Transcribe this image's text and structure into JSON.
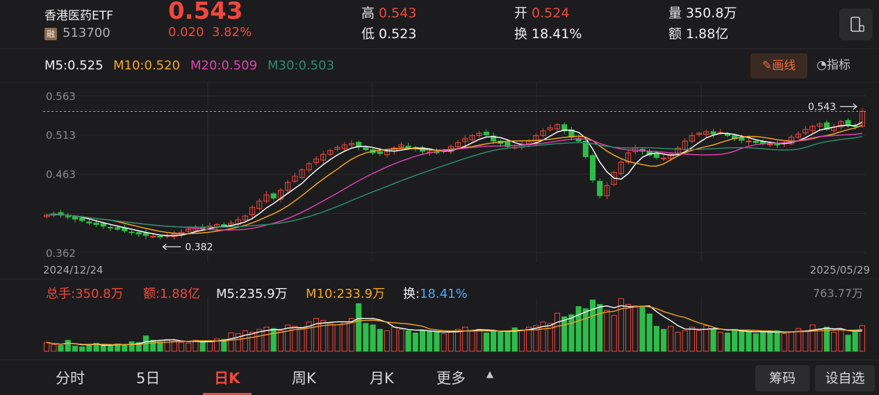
{
  "header": {
    "name": "香港医药ETF",
    "margin_badge": "融",
    "code": "513700",
    "price": "0.543",
    "change": "0.020",
    "change_pct": "3.82%",
    "high_label": "高",
    "high": "0.543",
    "low_label": "低",
    "low": "0.523",
    "open_label": "开",
    "open": "0.524",
    "turnover_label": "换",
    "turnover": "18.41%",
    "volume_label": "量",
    "volume": "350.8万",
    "amount_label": "额",
    "amount": "1.88亿"
  },
  "ma_legend": {
    "m5": "M5:0.525",
    "m10": "M10:0.520",
    "m20": "M20:0.509",
    "m30": "M30:0.503"
  },
  "toolbar": {
    "draw_label": "✎画线",
    "indicator_label": "指标"
  },
  "colors": {
    "up": "#f0483e",
    "down": "#2ebd4a",
    "m5": "#ffffff",
    "m10": "#f5a623",
    "m20": "#e040b0",
    "m30": "#2e8b6a"
  },
  "chart_data": [
    {
      "type": "candlestick",
      "ylim": [
        0.362,
        0.563
      ],
      "y_ticks": [
        "0.563",
        "0.513",
        "0.463",
        "0.362"
      ],
      "x_start": "2024/12/24",
      "x_end": "2025/05/29",
      "max_annotation": "0.543",
      "min_annotation": "0.382",
      "closes": [
        0.41,
        0.412,
        0.41,
        0.408,
        0.405,
        0.403,
        0.4,
        0.398,
        0.396,
        0.394,
        0.392,
        0.39,
        0.388,
        0.386,
        0.384,
        0.383,
        0.382,
        0.384,
        0.386,
        0.388,
        0.392,
        0.395,
        0.393,
        0.396,
        0.398,
        0.396,
        0.4,
        0.404,
        0.409,
        0.42,
        0.428,
        0.436,
        0.432,
        0.442,
        0.452,
        0.46,
        0.468,
        0.476,
        0.482,
        0.488,
        0.493,
        0.497,
        0.5,
        0.502,
        0.498,
        0.494,
        0.49,
        0.489,
        0.492,
        0.496,
        0.5,
        0.497,
        0.495,
        0.492,
        0.491,
        0.49,
        0.493,
        0.498,
        0.503,
        0.508,
        0.512,
        0.515,
        0.513,
        0.505,
        0.502,
        0.498,
        0.497,
        0.5,
        0.505,
        0.512,
        0.518,
        0.522,
        0.526,
        0.518,
        0.51,
        0.505,
        0.485,
        0.455,
        0.435,
        0.448,
        0.465,
        0.478,
        0.49,
        0.496,
        0.492,
        0.487,
        0.484,
        0.483,
        0.488,
        0.496,
        0.505,
        0.512,
        0.515,
        0.517,
        0.514,
        0.516,
        0.512,
        0.508,
        0.506,
        0.505,
        0.503,
        0.502,
        0.501,
        0.5,
        0.503,
        0.51,
        0.514,
        0.52,
        0.524,
        0.527,
        0.52,
        0.523,
        0.53,
        0.526,
        0.524,
        0.543
      ],
      "m5": "0.525",
      "m10": "0.520",
      "m20": "0.509",
      "m30": "0.503"
    },
    {
      "type": "bar",
      "max_label": "763.77万",
      "total_label": "总手:350.8万",
      "amount_label": "额:1.88亿",
      "m5_label": "M5:235.9万",
      "m10_label": "M10:233.9万",
      "turnover_label_prefix": "换:",
      "turnover_value": "18.41%",
      "values": [
        120,
        90,
        80,
        150,
        70,
        60,
        90,
        110,
        80,
        70,
        100,
        90,
        130,
        120,
        210,
        150,
        130,
        160,
        140,
        120,
        110,
        150,
        130,
        140,
        170,
        160,
        250,
        240,
        280,
        260,
        300,
        330,
        310,
        280,
        360,
        340,
        320,
        400,
        450,
        420,
        380,
        360,
        400,
        450,
        650,
        380,
        360,
        300,
        280,
        330,
        300,
        280,
        250,
        290,
        270,
        260,
        240,
        260,
        300,
        330,
        280,
        300,
        250,
        270,
        260,
        280,
        320,
        290,
        330,
        350,
        400,
        380,
        520,
        470,
        500,
        610,
        580,
        700,
        640,
        560,
        490,
        720,
        640,
        620,
        600,
        510,
        340,
        300,
        340,
        260,
        280,
        330,
        280,
        350,
        300,
        260,
        250,
        300,
        280,
        260,
        240,
        260,
        270,
        280,
        240,
        260,
        310,
        280,
        360,
        300,
        330,
        260,
        300,
        220,
        260,
        350
      ]
    }
  ],
  "tabs": [
    "分时",
    "5日",
    "日K",
    "周K",
    "月K",
    "更多"
  ],
  "active_tab": "日K",
  "right_buttons": {
    "chips": "筹码",
    "watchlist": "设自选"
  }
}
